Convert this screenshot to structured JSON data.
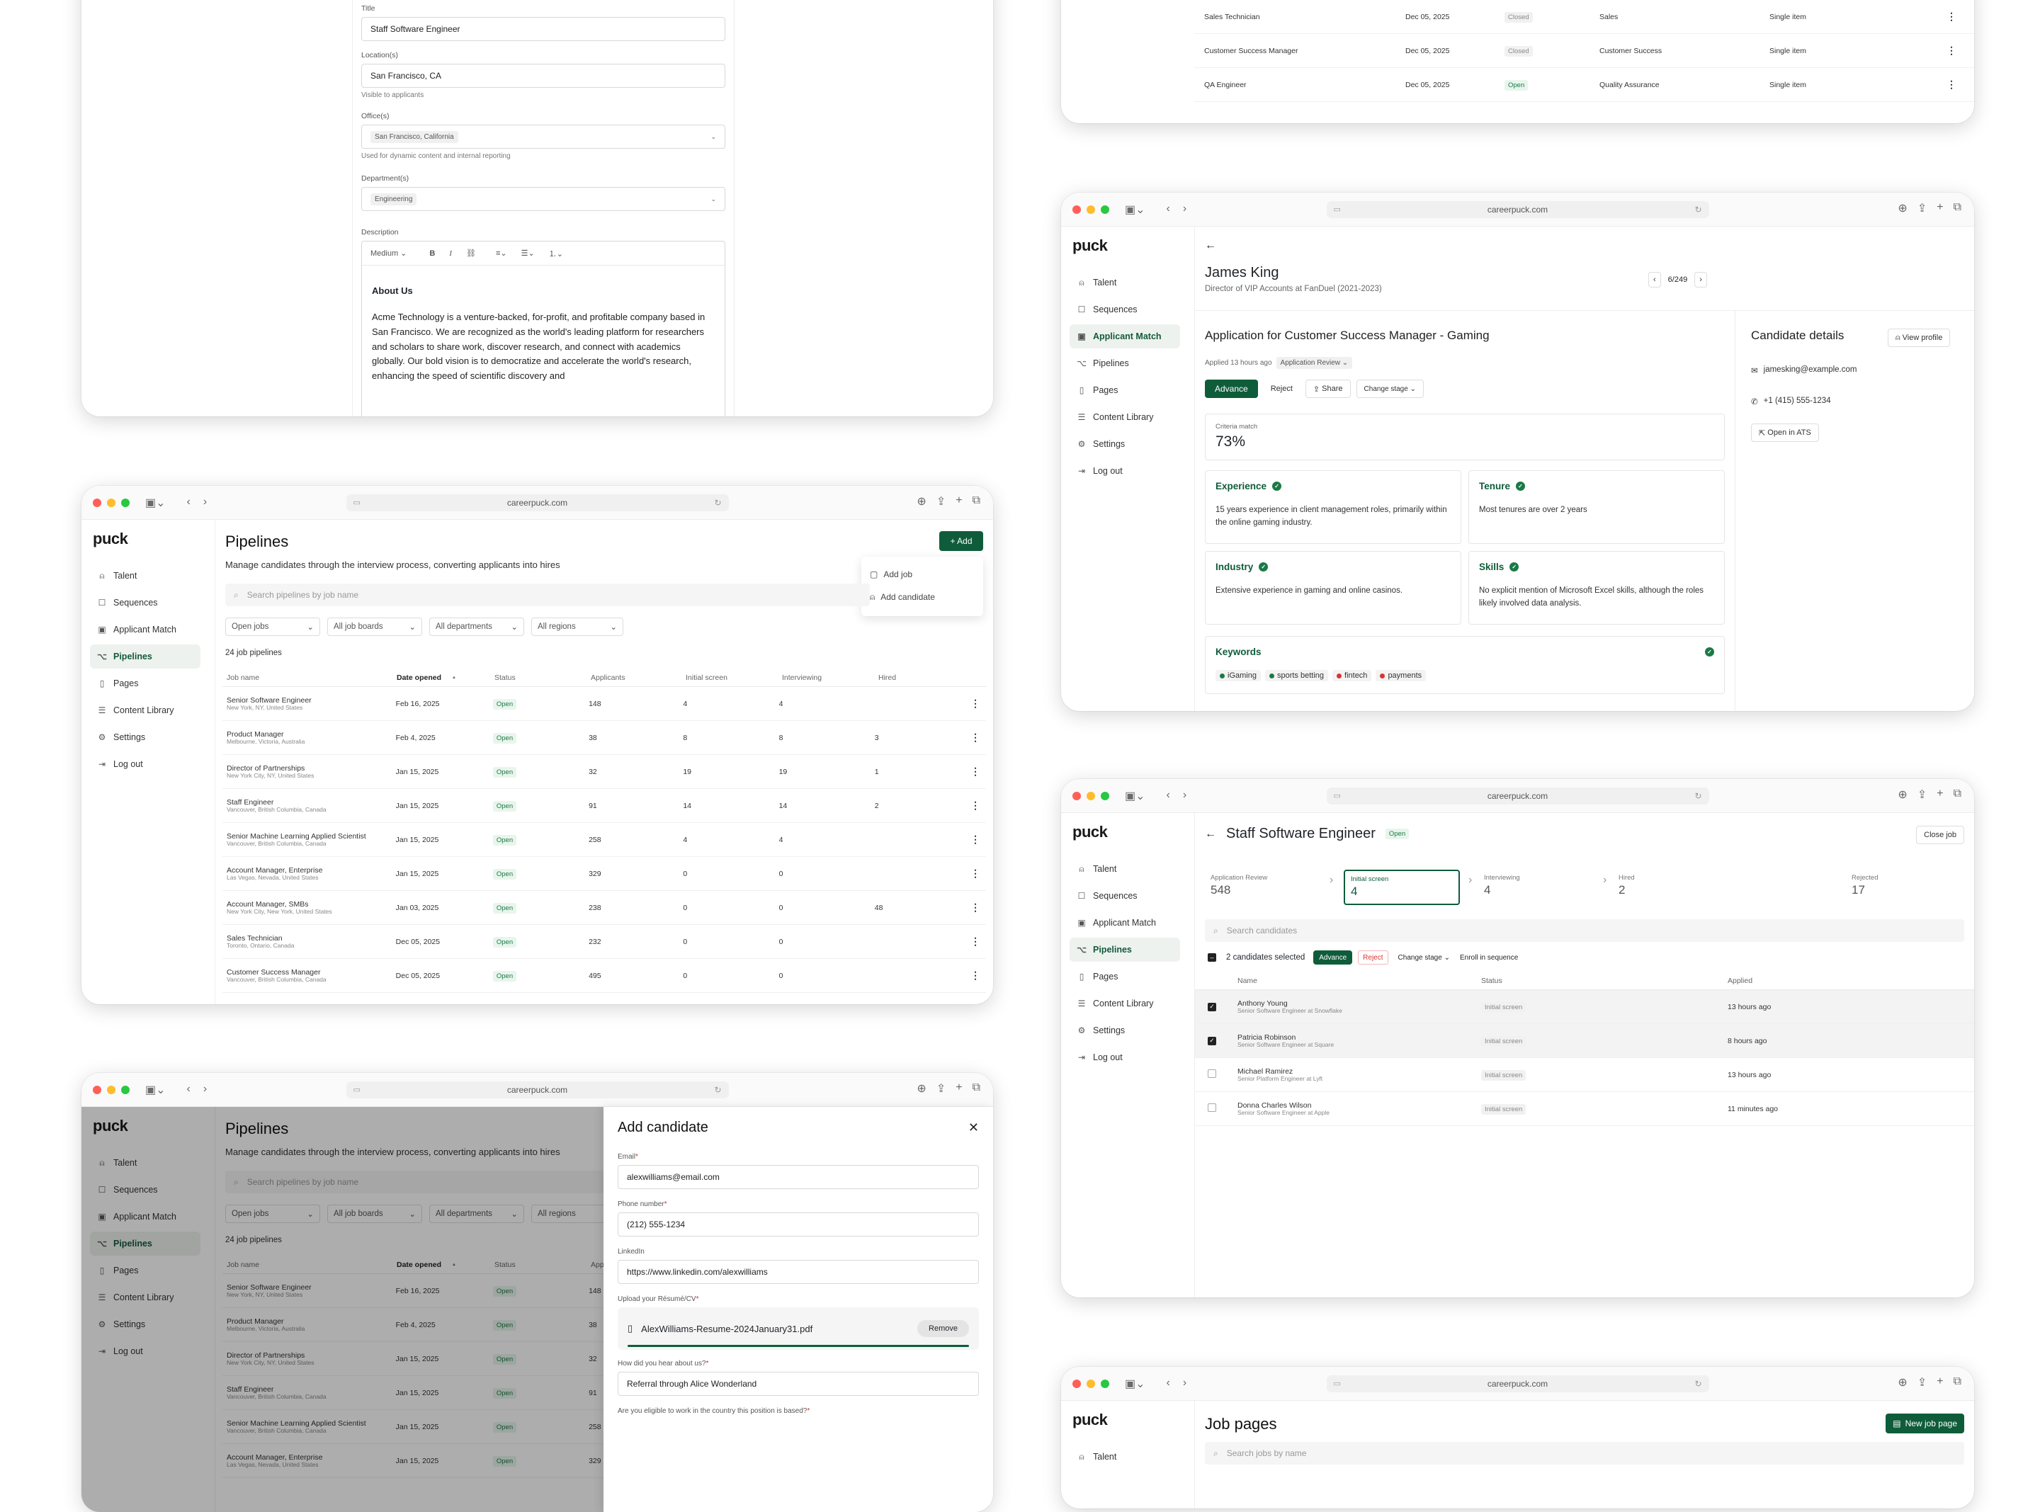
{
  "browser": {
    "url": "careerpuck.com"
  },
  "logo": "puck",
  "nav": [
    "Talent",
    "Sequences",
    "Applicant Match",
    "Pipelines",
    "Pages",
    "Content Library",
    "Settings",
    "Log out"
  ],
  "job_form": {
    "title_label": "Title",
    "title_value": "Staff Software Engineer",
    "location_label": "Location(s)",
    "location_value": "San Francisco, CA",
    "location_hint": "Visible to applicants",
    "office_label": "Office(s)",
    "office_value": "San Francisco, California",
    "office_hint": "Used for dynamic content and internal reporting",
    "department_label": "Department(s)",
    "department_value": "Engineering",
    "description_label": "Description",
    "style_value": "Medium",
    "about_heading": "About Us",
    "about_text": "Acme Technology is a venture-backed, for-profit, and profitable company based in San Francisco. We are recognized as the world's leading platform for researchers and scholars to share work, discover research, and connect with academics globally. Our bold vision is to democratize and accelerate the world's research, enhancing the speed of scientific discovery and"
  },
  "jobs_top": [
    {
      "name": "Sales Technician",
      "date": "Dec 05, 2025",
      "status": "Closed",
      "dept": "Sales",
      "type": "Single item"
    },
    {
      "name": "Customer Success Manager",
      "date": "Dec 05, 2025",
      "status": "Closed",
      "dept": "Customer Success",
      "type": "Single item"
    },
    {
      "name": "QA Engineer",
      "date": "Dec 05, 2025",
      "status": "Open",
      "dept": "Quality Assurance",
      "type": "Single item"
    }
  ],
  "pipelines": {
    "title": "Pipelines",
    "subtitle": "Manage candidates through the interview process, converting applicants into hires",
    "add_label": "+ Add",
    "menu_add_job": "Add job",
    "menu_add_candidate": "Add candidate",
    "search_placeholder": "Search pipelines by job name",
    "filters": [
      "Open jobs",
      "All job boards",
      "All departments",
      "All regions"
    ],
    "count": "24 job pipelines",
    "columns": [
      "Job name",
      "Date opened",
      "Status",
      "Applicants",
      "Initial screen",
      "Interviewing",
      "Hired"
    ],
    "rows": [
      {
        "name": "Senior Software Engineer",
        "loc": "New York, NY, United States",
        "date": "Feb 16, 2025",
        "status": "Open",
        "applicants": "148",
        "screen": "4",
        "interview": "4",
        "hired": ""
      },
      {
        "name": "Product Manager",
        "loc": "Melbourne, Victoria, Australia",
        "date": "Feb 4, 2025",
        "status": "Open",
        "applicants": "38",
        "screen": "8",
        "interview": "8",
        "hired": "3"
      },
      {
        "name": "Director of Partnerships",
        "loc": "New York City, NY, United States",
        "date": "Jan 15, 2025",
        "status": "Open",
        "applicants": "32",
        "screen": "19",
        "interview": "19",
        "hired": "1"
      },
      {
        "name": "Staff Engineer",
        "loc": "Vancouver, British Columbia, Canada",
        "date": "Jan 15, 2025",
        "status": "Open",
        "applicants": "91",
        "screen": "14",
        "interview": "14",
        "hired": "2"
      },
      {
        "name": "Senior Machine Learning Applied Scientist",
        "loc": "Vancouver, British Columbia, Canada",
        "date": "Jan 15, 2025",
        "status": "Open",
        "applicants": "258",
        "screen": "4",
        "interview": "4",
        "hired": ""
      },
      {
        "name": "Account Manager, Enterprise",
        "loc": "Las Vegas, Nevada, United States",
        "date": "Jan 15, 2025",
        "status": "Open",
        "applicants": "329",
        "screen": "0",
        "interview": "0",
        "hired": ""
      },
      {
        "name": "Account Manager, SMBs",
        "loc": "New York City, New York, United States",
        "date": "Jan 03, 2025",
        "status": "Open",
        "applicants": "238",
        "screen": "0",
        "interview": "0",
        "hired": "48"
      },
      {
        "name": "Sales Technician",
        "loc": "Toronto, Ontario, Canada",
        "date": "Dec 05, 2025",
        "status": "Open",
        "applicants": "232",
        "screen": "0",
        "interview": "0",
        "hired": ""
      },
      {
        "name": "Customer Success Manager",
        "loc": "Vancouver, British Columbia, Canada",
        "date": "Dec 05, 2025",
        "status": "Open",
        "applicants": "495",
        "screen": "0",
        "interview": "0",
        "hired": ""
      }
    ]
  },
  "add_candidate": {
    "title": "Add candidate",
    "email_label": "Email",
    "email_value": "alexwilliams@email.com",
    "phone_label": "Phone number",
    "phone_value": "(212) 555-1234",
    "linkedin_label": "LinkedIn",
    "linkedin_value": "https://www.linkedin.com/alexwilliams",
    "resume_label": "Upload your Résumé/CV",
    "resume_file": "AlexWilliams-Resume-2024January31.pdf",
    "remove_label": "Remove",
    "hear_label": "How did you hear about us?",
    "hear_value": "Referral through Alice Wonderland",
    "eligible_label": "Are you eligible to work in the country this position is based?"
  },
  "applicant": {
    "name": "James King",
    "headline": "Director of VIP Accounts at FanDuel (2021-2023)",
    "pager": "6/249",
    "app_title": "Application for Customer Success Manager - Gaming",
    "applied": "Applied 13 hours ago",
    "stage": "Application Review",
    "advance": "Advance",
    "reject": "Reject",
    "share": "Share",
    "change_stage": "Change stage",
    "criteria_label": "Criteria match",
    "criteria_value": "73%",
    "criteria": [
      {
        "title": "Experience",
        "text": "15 years experience in client management roles, primarily within the online gaming industry."
      },
      {
        "title": "Tenure",
        "text": "Most tenures are over 2 years"
      },
      {
        "title": "Industry",
        "text": "Extensive experience in gaming and online casinos."
      },
      {
        "title": "Skills",
        "text": "No explicit mention of Microsoft Excel skills, although the roles likely involved data analysis."
      }
    ],
    "keywords_title": "Keywords",
    "keywords": [
      {
        "label": "iGaming",
        "match": "yes"
      },
      {
        "label": "sports betting",
        "match": "yes"
      },
      {
        "label": "fintech",
        "match": "no"
      },
      {
        "label": "payments",
        "match": "no"
      }
    ],
    "details_title": "Candidate details",
    "view_profile": "View profile",
    "email": "jamesking@example.com",
    "phone": "+1 (415) 555-1234",
    "open_ats": "Open in ATS"
  },
  "job_detail": {
    "title": "Staff Software Engineer",
    "status": "Open",
    "close": "Close job",
    "stages": [
      {
        "label": "Application Review",
        "count": "548"
      },
      {
        "label": "Initial screen",
        "count": "4"
      },
      {
        "label": "Interviewing",
        "count": "4"
      },
      {
        "label": "Hired",
        "count": "2"
      },
      {
        "label": "Rejected",
        "count": "17"
      }
    ],
    "search_placeholder": "Search candidates",
    "selected": "2 candidates selected",
    "advance": "Advance",
    "reject": "Reject",
    "change_stage": "Change stage",
    "enroll": "Enroll in sequence",
    "columns": [
      "Name",
      "Status",
      "Applied"
    ],
    "rows": [
      {
        "name": "Anthony Young",
        "role": "Senior Software Engineer at Snowflake",
        "status": "Initial screen",
        "applied": "13 hours ago",
        "checked": true
      },
      {
        "name": "Patricia Robinson",
        "role": "Senior Software Engineer at Square",
        "status": "Initial screen",
        "applied": "8 hours ago",
        "checked": true
      },
      {
        "name": "Michael Ramirez",
        "role": "Senior Platform Engineer at Lyft",
        "status": "Initial screen",
        "applied": "13 hours ago",
        "checked": false
      },
      {
        "name": "Donna Charles Wilson",
        "role": "Senior Software Engineer at Apple",
        "status": "Initial screen",
        "applied": "11 minutes ago",
        "checked": false
      }
    ]
  },
  "job_pages": {
    "title": "Job pages",
    "new_button": "New job page",
    "search_placeholder": "Search jobs by name"
  },
  "colors": {
    "brand_green": "#0f5c3b",
    "open_badge": "#e8f5ec",
    "reject_red": "#d33"
  }
}
